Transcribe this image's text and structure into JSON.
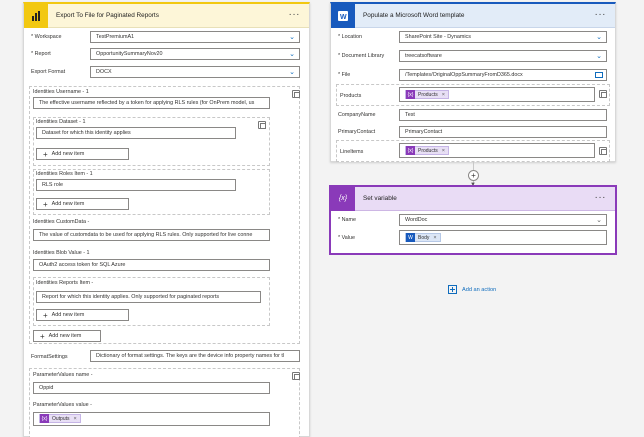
{
  "colors": {
    "powerbi": "#f2c811",
    "word": "#185abd",
    "variable": "#8a3ab9",
    "link": "#0f6cbd"
  },
  "left": {
    "title": "Export To File for Paginated Reports",
    "menu": "···",
    "workspace": {
      "label": "* Workspace",
      "value": "TestPremiumA1"
    },
    "report": {
      "label": "* Report",
      "value": "OpportunitySummaryNov20"
    },
    "export_format": {
      "label": "Export Format",
      "value": "DOCX"
    },
    "identities_username": {
      "label": "Identities Username - 1",
      "value": "The effective username reflected by a token for applying RLS rules (for OnPrem model, us"
    },
    "identities_dataset": {
      "label": "Identities Dataset - 1",
      "value": "Dataset for which this identity applies"
    },
    "add_new_item": "Add new item",
    "identities_roles": {
      "label": "Identities Roles Item - 1",
      "value": "RLS role"
    },
    "identities_customdata": {
      "label": "Identities CustomData -",
      "value": "The value of customdata to be used for applying RLS rules. Only supported for live conne"
    },
    "identities_blob": {
      "label": "Identities Blob Value - 1",
      "value": "OAuth2 access token for SQL Azure"
    },
    "identities_reports": {
      "label": "Identities Reports Item -",
      "value": "Report for which this identity applies. Only supported for paginated reports"
    },
    "format_settings": {
      "label": "FormatSettings",
      "value": "Dictionary of format settings. The keys are the device info property names for tl"
    },
    "param_name": {
      "label": "ParameterValues name -",
      "value": "Oppid"
    },
    "param_value": {
      "label": "ParameterValues value -",
      "token": "Outputs",
      "token_x": "×"
    }
  },
  "right": {
    "title": "Populate a Microsoft Word template",
    "menu": "···",
    "location": {
      "label": "* Location",
      "value": "SharePoint Site - Dynamics"
    },
    "doclib": {
      "label": "* Document Library",
      "value": "treecatsoftware"
    },
    "file": {
      "label": "* File",
      "value": "/Templates/OriginalOppSummaryFromD365.docx"
    },
    "products": {
      "label": "Products",
      "token": "Products",
      "token_x": "×"
    },
    "company": {
      "label": "CompanyName",
      "value": "Test"
    },
    "primary": {
      "label": "PrimaryContact",
      "value": "PrimaryContact"
    },
    "lineitems": {
      "label": "LineItems",
      "token": "Products",
      "token_x": "×"
    }
  },
  "setvar": {
    "title": "Set variable",
    "menu": "···",
    "name": {
      "label": "* Name",
      "value": "WordDoc"
    },
    "value": {
      "label": "* Value",
      "token": "Body",
      "token_x": "×"
    }
  },
  "add_action": "Add an action"
}
